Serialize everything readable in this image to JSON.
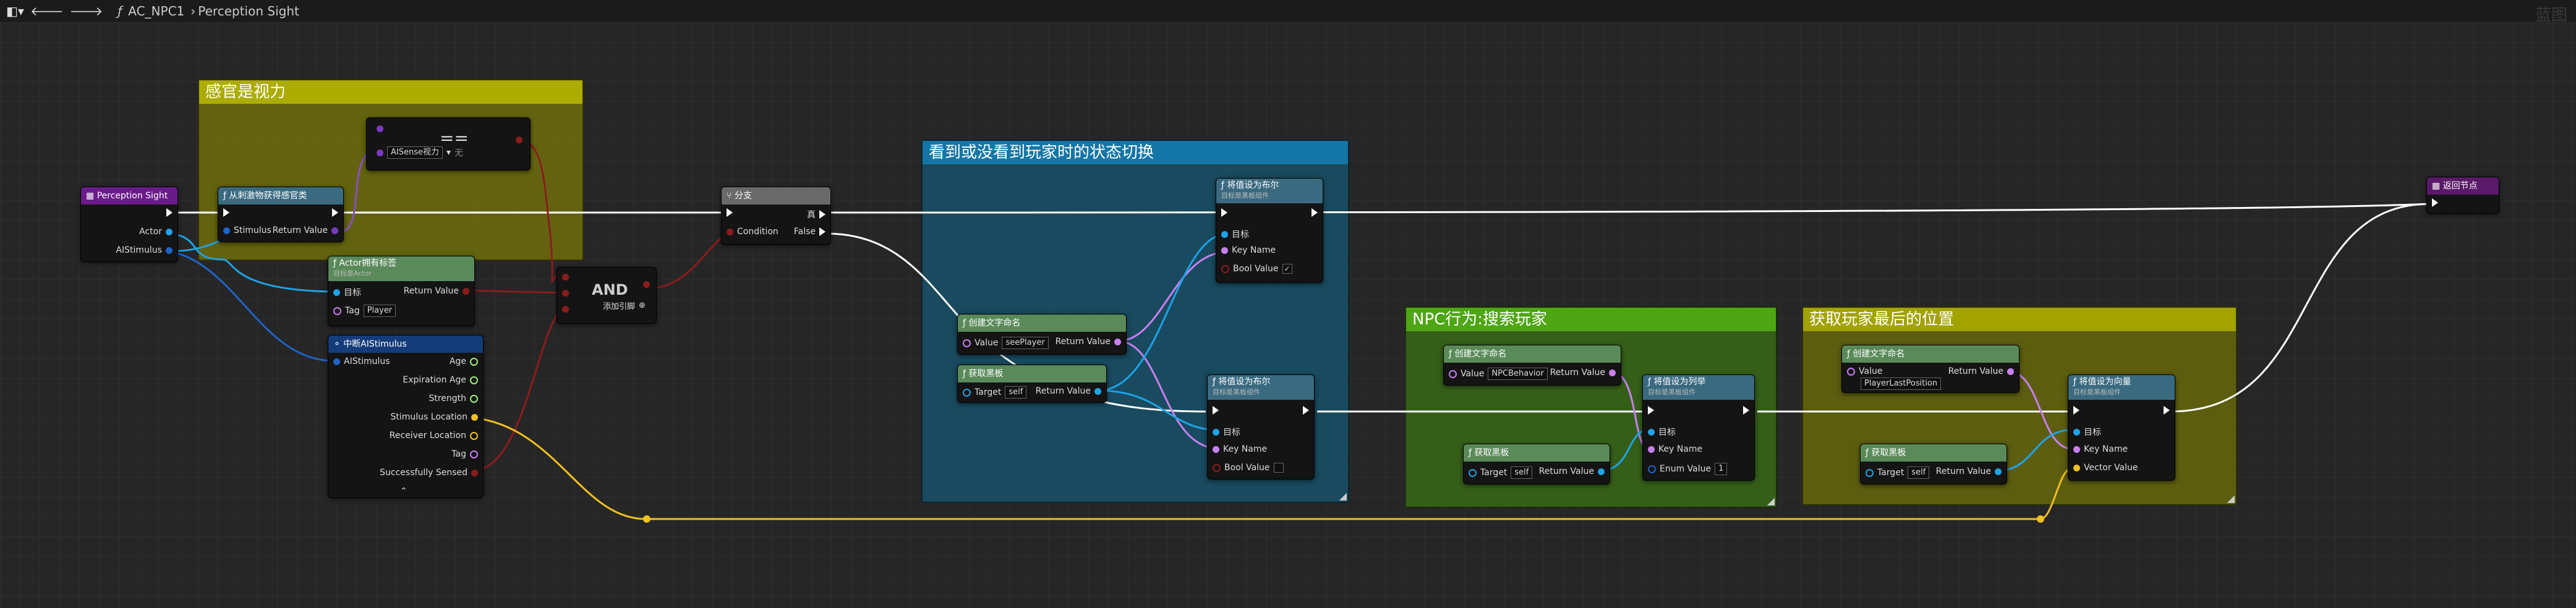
{
  "topbar": {
    "blueprint": "AC_NPC1",
    "function": "Perception Sight",
    "watermark": "蓝图"
  },
  "comments": {
    "sight": "感官是视力",
    "state": "看到或没看到玩家时的状态切换",
    "search": "NPC行为:搜索玩家",
    "lastpos": "获取玩家最后的位置"
  },
  "nodes": {
    "entry": {
      "title": "Perception Sight",
      "actor": "Actor",
      "stimulus": "AIStimulus"
    },
    "getsense": {
      "title": "从刺激物获得感官类",
      "stimulus": "Stimulus",
      "ret": "Return Value"
    },
    "equal": {
      "op": "==",
      "sel": "AISense视力",
      "none": "无"
    },
    "hastag": {
      "title": "Actor拥有标签",
      "sub": "目标是Actor",
      "target": "目标",
      "tag": "Tag",
      "tag_val": "Player",
      "ret": "Return Value"
    },
    "and": {
      "title": "AND",
      "add": "添加引脚"
    },
    "breakstim": {
      "title": "中断AIStimulus",
      "stim": "AIStimulus",
      "age": "Age",
      "exp": "Expiration Age",
      "str": "Strength",
      "sloc": "Stimulus Location",
      "rloc": "Receiver Location",
      "tag": "Tag",
      "sensed": "Successfully Sensed"
    },
    "branch": {
      "title": "分支",
      "cond": "Condition",
      "t": "真",
      "f": "False"
    },
    "setbool1": {
      "title": "将值设为布尔",
      "sub": "目标是黑板组件",
      "target": "目标",
      "key": "Key Name",
      "bool": "Bool Value"
    },
    "makename1": {
      "title": "创建文字命名",
      "value": "Value",
      "value_val": "seePlayer",
      "ret": "Return Value"
    },
    "getbb1": {
      "title": "获取黑板",
      "target": "Target",
      "target_val": "self",
      "ret": "Return Value"
    },
    "setbool2": {
      "title": "将值设为布尔",
      "sub": "目标是黑板组件",
      "target": "目标",
      "key": "Key Name",
      "bool": "Bool Value"
    },
    "makename2": {
      "title": "创建文字命名",
      "value": "Value",
      "value_val": "NPCBehavior",
      "ret": "Return Value"
    },
    "getbb2": {
      "title": "获取黑板",
      "target": "Target",
      "target_val": "self",
      "ret": "Return Value"
    },
    "setenum": {
      "title": "将值设为列举",
      "sub": "目标是黑板组件",
      "target": "目标",
      "key": "Key Name",
      "enum": "Enum Value",
      "enum_val": "1"
    },
    "makename3": {
      "title": "创建文字命名",
      "value": "Value",
      "value_val": "PlayerLastPosition",
      "ret": "Return Value"
    },
    "getbb3": {
      "title": "获取黑板",
      "target": "Target",
      "target_val": "self",
      "ret": "Return Value"
    },
    "setvec": {
      "title": "将值设为向量",
      "sub": "目标是黑板组件",
      "target": "目标",
      "key": "Key Name",
      "vec": "Vector Value"
    },
    "ret": {
      "title": "返回节点"
    }
  },
  "colors": {
    "exec": "#ffffff",
    "object": "#1ea3e6",
    "name": "#c880f0",
    "bool": "#8c1c1c",
    "vector": "#f0c020",
    "struct": "#1e64c8",
    "float": "#a0f080",
    "entry_header": "#6a1b8a",
    "return_header": "#5a1a6a"
  }
}
